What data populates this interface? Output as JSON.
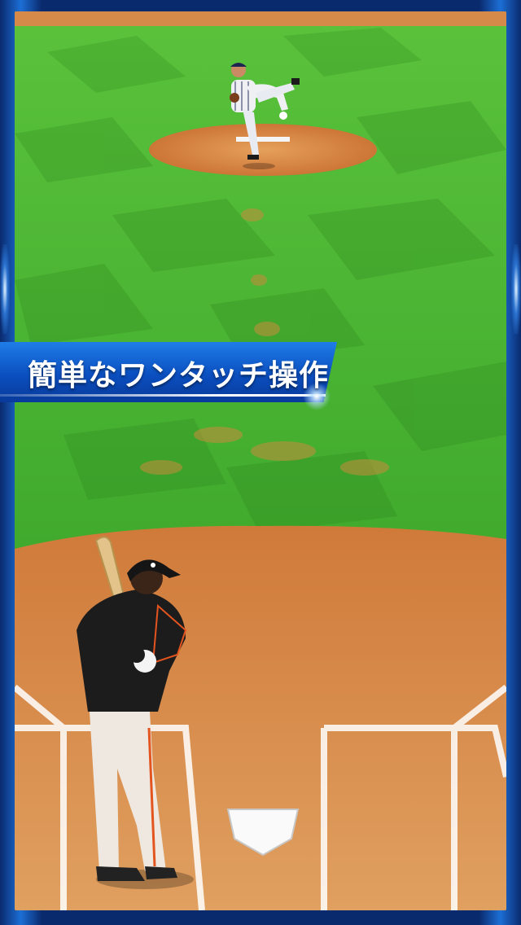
{
  "screen": {
    "caption": "簡単なワンタッチ操作"
  },
  "colors": {
    "frame": "#0a2a6e",
    "banner": "#0b4fc0",
    "grass": "#3fae2c",
    "dirt": "#d98a45",
    "chalk": "#ffffff"
  },
  "icons": [
    "pitcher-figure-icon",
    "batter-figure-icon",
    "home-plate-icon",
    "pitcher-mound-icon"
  ]
}
